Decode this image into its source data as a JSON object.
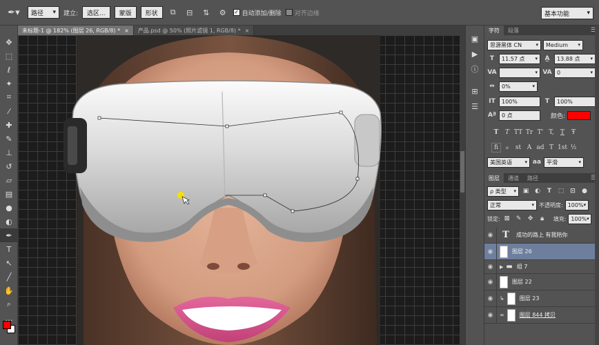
{
  "options_bar": {
    "path_mode": "路径",
    "make_label": "建立:",
    "selection_button": "选区...",
    "mask_button": "蒙版",
    "shape_button": "形状",
    "auto_add_delete_label": "自动添加/删除",
    "align_edges_label": "对齐边缘",
    "workspace": "基本功能"
  },
  "tabs": [
    {
      "label": "未标题-1 @ 182% (图层 26, RGB/8) *",
      "close": "×"
    },
    {
      "label": "产品.psd @ 50% (照片滤镜 1, RGB/8) *",
      "close": "×"
    }
  ],
  "character_panel": {
    "tabs": [
      "字符",
      "段落"
    ],
    "font_family": "思源黑体 CN",
    "font_style": "Medium",
    "font_size": "11.57 点",
    "leading": "13.88 点",
    "kerning": "",
    "tracking": "0",
    "vertical_scale_pct": "0%",
    "scale_v": "100%",
    "scale_h": "100%",
    "baseline_shift": "0 点",
    "color_label": "颜色:",
    "color_value": "#ff0000",
    "language": "美国英语",
    "antialias": "平滑",
    "glyph_buttons": [
      "T",
      "T",
      "TT",
      "Tr",
      "T'",
      "T,",
      "T",
      "Ŧ"
    ],
    "opentype_buttons": [
      "fi",
      "ℴ",
      "st",
      "A",
      "ad",
      "T",
      "1st",
      "½"
    ]
  },
  "layers_panel": {
    "tabs": [
      "图层",
      "通道",
      "路径"
    ],
    "filter_kind": "ρ 类型",
    "blend_mode": "正常",
    "opacity_label": "不透明度:",
    "opacity_value": "100%",
    "lock_label": "锁定:",
    "fill_label": "填充:",
    "fill_value": "100%",
    "layers": [
      {
        "name": "成功的路上 有我陪你",
        "kind": "text",
        "selected": false
      },
      {
        "name": "图层 26",
        "kind": "pixel",
        "selected": true
      },
      {
        "name": "组 7",
        "kind": "group",
        "selected": false
      },
      {
        "name": "图层 22",
        "kind": "pixel",
        "selected": false
      },
      {
        "name": "图层 23",
        "kind": "pixel",
        "selected": false
      },
      {
        "name": "图层 844 拷贝",
        "kind": "pixel",
        "selected": false
      }
    ]
  },
  "colors": {
    "foreground": "#ff0000",
    "background": "#ffffff",
    "selected_layer": "#6e7f9e"
  }
}
